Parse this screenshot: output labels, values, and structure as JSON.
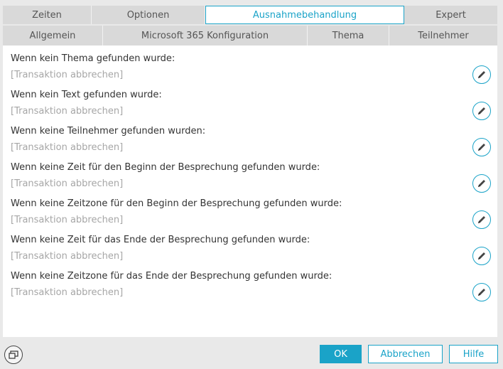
{
  "tabs_row1": [
    {
      "label": "Zeiten",
      "active": false
    },
    {
      "label": "Optionen",
      "active": false
    },
    {
      "label": "Ausnahmebehandlung",
      "active": true
    },
    {
      "label": "Expert",
      "active": false
    }
  ],
  "tabs_row2": [
    {
      "label": "Allgemein"
    },
    {
      "label": "Microsoft 365 Konfiguration"
    },
    {
      "label": "Thema"
    },
    {
      "label": "Teilnehmer"
    }
  ],
  "items": [
    {
      "label": "Wenn kein Thema gefunden wurde:",
      "value": "[Transaktion abbrechen]"
    },
    {
      "label": "Wenn kein Text gefunden wurde:",
      "value": "[Transaktion abbrechen]"
    },
    {
      "label": "Wenn keine Teilnehmer gefunden wurden:",
      "value": "[Transaktion abbrechen]"
    },
    {
      "label": "Wenn keine Zeit für den Beginn der Besprechung gefunden wurde:",
      "value": "[Transaktion abbrechen]"
    },
    {
      "label": "Wenn keine Zeitzone für den Beginn der Besprechung gefunden wurde:",
      "value": "[Transaktion abbrechen]"
    },
    {
      "label": "Wenn keine Zeit für das Ende der Besprechung gefunden wurde:",
      "value": "[Transaktion abbrechen]"
    },
    {
      "label": "Wenn keine Zeitzone für das Ende der Besprechung gefunden wurde:",
      "value": "[Transaktion abbrechen]"
    }
  ],
  "item_action_icon": "pencil-icon",
  "footer": {
    "ok": "OK",
    "cancel": "Abbrechen",
    "help": "Hilfe",
    "left_icon": "window-icon"
  },
  "colors": {
    "accent": "#1aa3c8",
    "tab_bg": "#d9d9d9",
    "placeholder": "#a6a6a6"
  }
}
